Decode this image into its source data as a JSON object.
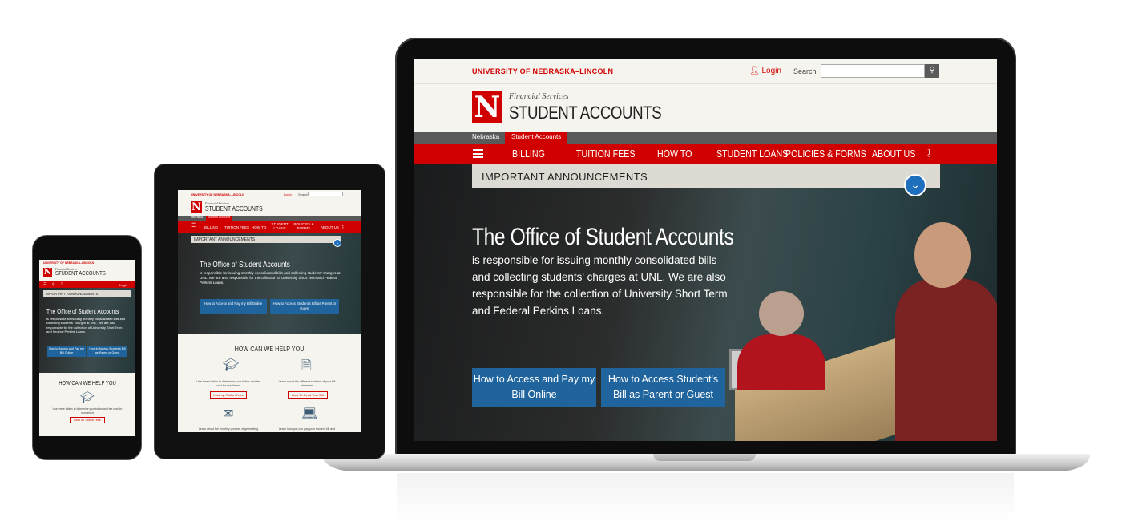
{
  "site": {
    "university": "UNIVERSITY OF NEBRASKA–LINCOLN",
    "login": "Login",
    "search_label": "Search",
    "search_placeholder": "",
    "logo_letter": "N",
    "department": "Financial Services",
    "unit_title": "STUDENT ACCOUNTS",
    "breadcrumbs": [
      "Nebraska",
      "Student Accounts"
    ],
    "nav": [
      "BILLING",
      "TUITION FEES",
      "HOW TO",
      "STUDENT LOANS",
      "POLICIES & FORMS",
      "ABOUT US"
    ],
    "announcement": "IMPORTANT ANNOUNCEMENTS",
    "hero_heading": "The Office of Student Accounts",
    "hero_text": "is responsible for issuing monthly consolidated bills and collecting students' charges at UNL. We are also responsible for the collection of University Short Term and Federal Perkins Loans.",
    "buttons": [
      "How to Access and Pay my Bill Online",
      "How to Access Student's Bill as Parent or Guest"
    ],
    "help_heading": "HOW CAN WE HELP YOU",
    "help_items": [
      {
        "icon": "graduation-cap-icon",
        "text": "Use these tables to determine your tuition and fee cost for enrollment",
        "link": "Look up Tuition Fees"
      },
      {
        "icon": "bill-document-icon",
        "text": "Learn about the different sections of your bill statement",
        "link": "How To Read Your Bill"
      },
      {
        "icon": "envelope-download-icon",
        "text": "Learn about the monthly process of generating",
        "link": ""
      },
      {
        "icon": "payment-screen-icon",
        "text": "Learn how you can pay your student bill and",
        "link": ""
      }
    ]
  },
  "colors": {
    "brand_red": "#d00000",
    "button_blue": "#20649e",
    "background": "#f6f4ef"
  }
}
